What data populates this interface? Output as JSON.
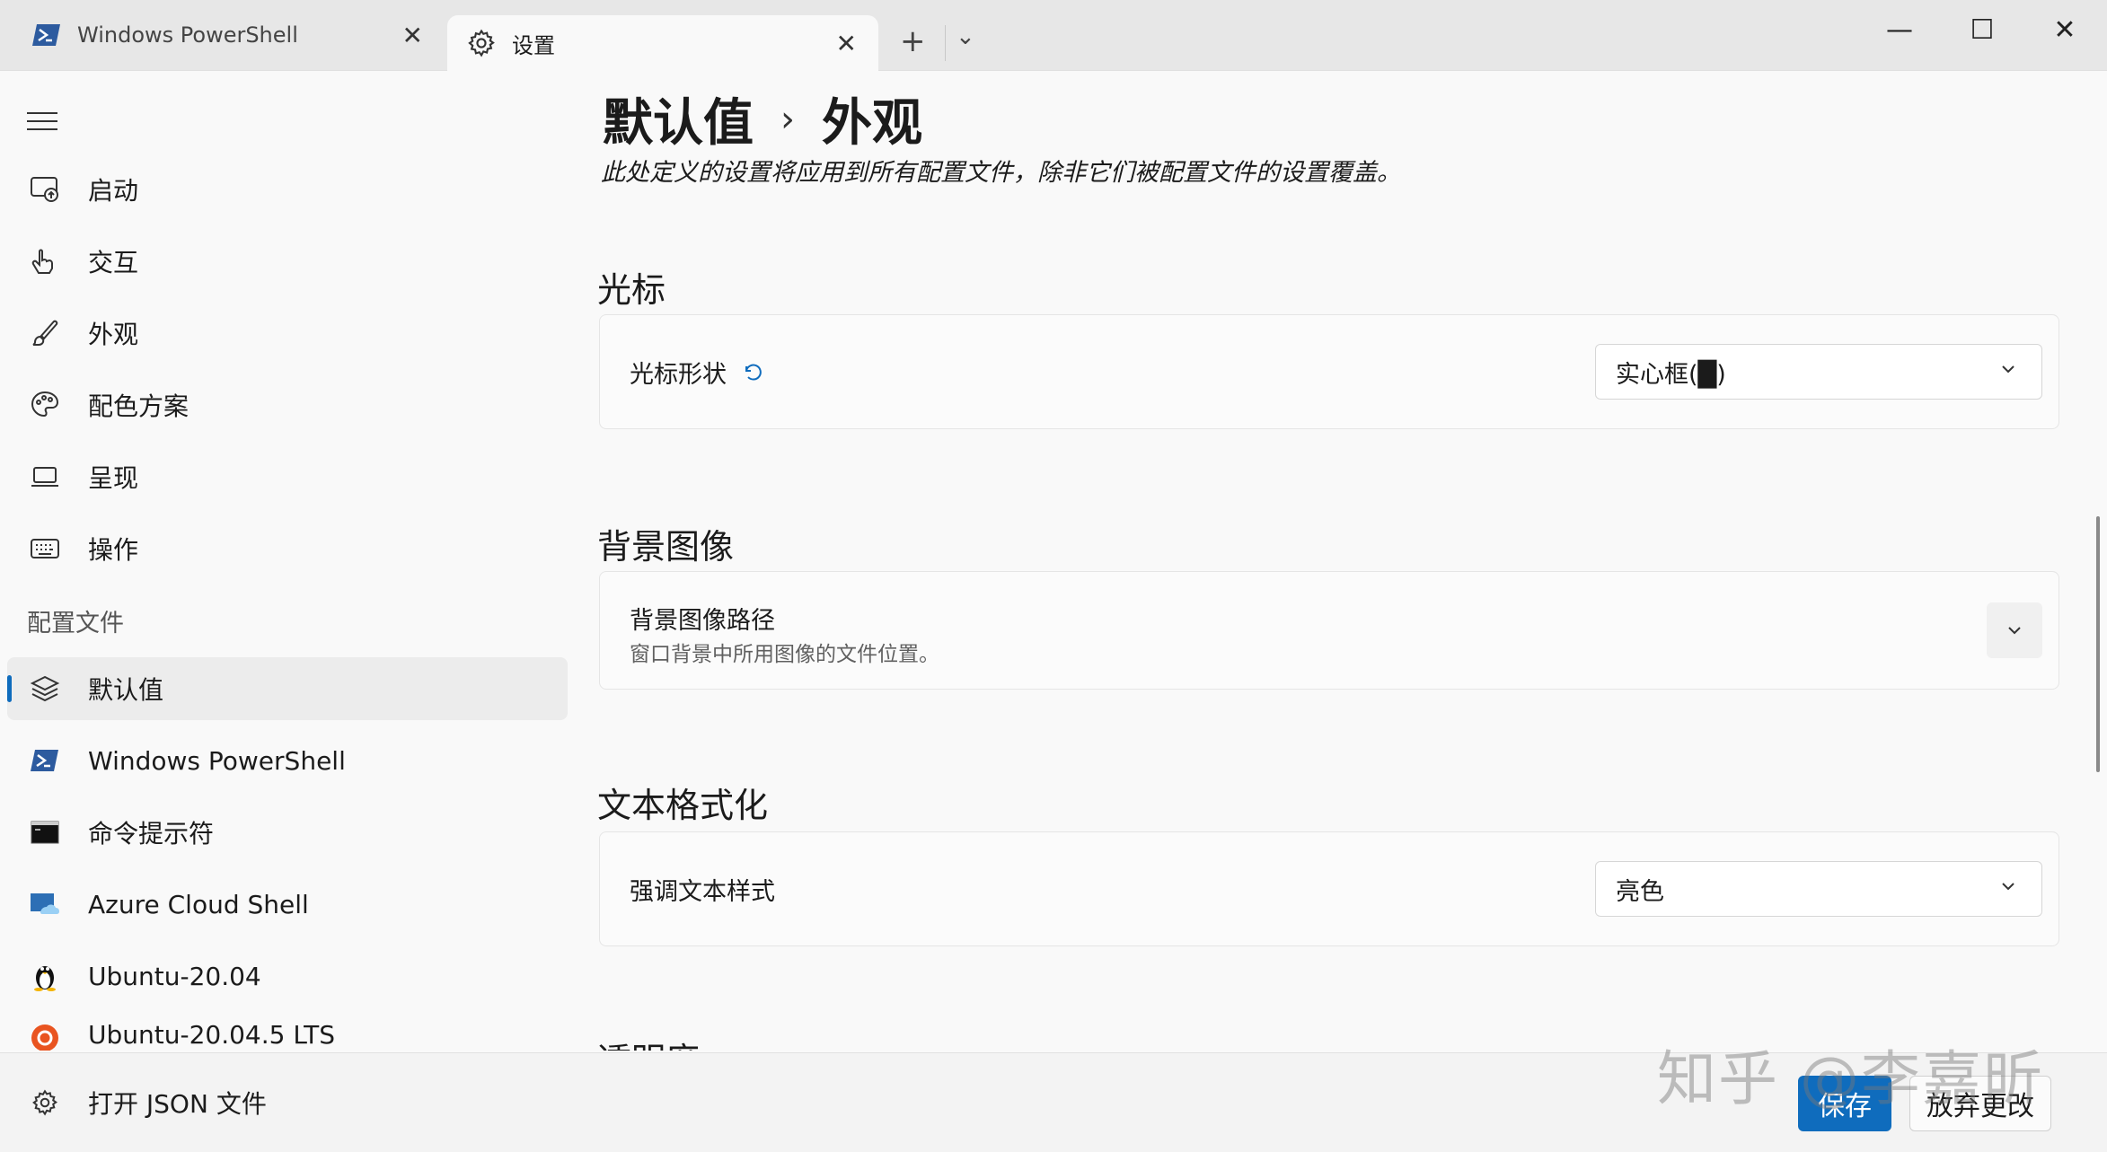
{
  "tabs": [
    {
      "label": "Windows PowerShell",
      "icon": "powershell-icon"
    },
    {
      "label": "设置",
      "icon": "gear-icon"
    }
  ],
  "window_controls": {
    "minimize": "—",
    "maximize": "☐",
    "close": "✕"
  },
  "sidebar": {
    "items": [
      {
        "label": "启动",
        "icon": "launch-icon"
      },
      {
        "label": "交互",
        "icon": "pointer-hand-icon"
      },
      {
        "label": "外观",
        "icon": "brush-icon"
      },
      {
        "label": "配色方案",
        "icon": "palette-icon"
      },
      {
        "label": "呈现",
        "icon": "laptop-icon"
      },
      {
        "label": "操作",
        "icon": "keyboard-icon"
      }
    ],
    "section": "配置文件",
    "profiles": [
      {
        "label": "默认值",
        "icon": "layers-icon",
        "selected": true
      },
      {
        "label": "Windows PowerShell",
        "icon": "powershell-icon"
      },
      {
        "label": "命令提示符",
        "icon": "cmd-icon"
      },
      {
        "label": "Azure Cloud Shell",
        "icon": "azure-icon"
      },
      {
        "label": "Ubuntu-20.04",
        "icon": "tux-icon"
      },
      {
        "label": "Ubuntu-20.04.5 LTS",
        "icon": "ubuntu-icon"
      }
    ],
    "footer_item": {
      "label": "打开 JSON 文件",
      "icon": "gear-icon"
    }
  },
  "main": {
    "breadcrumb": [
      "默认值",
      "外观"
    ],
    "breadcrumb_separator": "›",
    "subtitle": "此处定义的设置将应用到所有配置文件，除非它们被配置文件的设置覆盖。",
    "sections": [
      {
        "title": "光标",
        "setting": {
          "label": "光标形状",
          "value": "实心框(█)",
          "has_reset": true
        }
      },
      {
        "title": "背景图像",
        "setting": {
          "label": "背景图像路径",
          "description": "窗口背景中所用图像的文件位置。"
        }
      },
      {
        "title": "文本格式化",
        "setting": {
          "label": "强调文本样式",
          "value": "亮色"
        }
      },
      {
        "title": "透明度"
      }
    ]
  },
  "actions": {
    "save": "保存",
    "discard": "放弃更改"
  },
  "watermark": "知乎 @李嘉昕",
  "colors": {
    "accent": "#0f6cbd",
    "background": "#f9f9f9",
    "titlebar": "#e7e7e7"
  }
}
